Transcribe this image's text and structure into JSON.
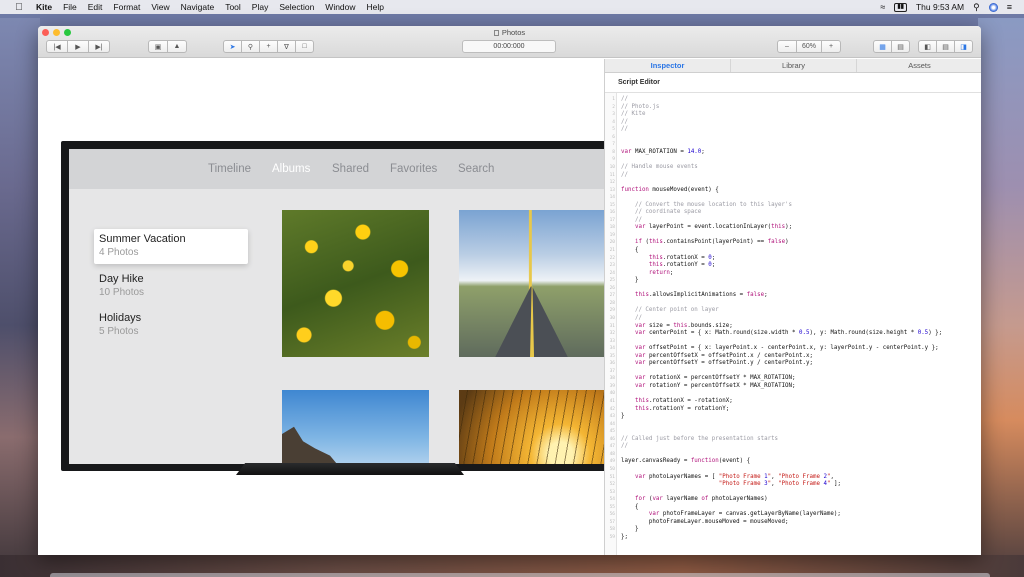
{
  "menubar": {
    "app_name": "Kite",
    "items": [
      "File",
      "Edit",
      "Format",
      "View",
      "Navigate",
      "Tool",
      "Play",
      "Selection",
      "Window",
      "Help"
    ],
    "clock": "Thu 9:53 AM"
  },
  "window": {
    "title": "Photos",
    "timecode": "00:00:000",
    "zoom": "60%"
  },
  "tv_app": {
    "nav": [
      "Timeline",
      "Albums",
      "Shared",
      "Favorites",
      "Search"
    ],
    "active_nav": "Albums",
    "albums": [
      {
        "title": "Summer Vacation",
        "count": "4 Photos"
      },
      {
        "title": "Day Hike",
        "count": "10 Photos"
      },
      {
        "title": "Holidays",
        "count": "5 Photos"
      }
    ]
  },
  "inspector": {
    "tabs": [
      "Inspector",
      "Library",
      "Assets"
    ],
    "active_tab": "Inspector",
    "section_title": "Script Editor",
    "code_lines": [
      "//",
      "// Photo.js",
      "// Kite",
      "//",
      "//",
      "",
      "",
      "var MAX_ROTATION = 14.0;",
      "",
      "// Handle mouse events",
      "//",
      "",
      "function mouseMoved(event) {",
      "",
      "    // Convert the mouse location to this layer's",
      "    // coordinate space",
      "    //",
      "    var layerPoint = event.locationInLayer(this);",
      "",
      "    if (this.containsPoint(layerPoint) == false)",
      "    {",
      "        this.rotationX = 0;",
      "        this.rotationY = 0;",
      "        return;",
      "    }",
      "",
      "    this.allowsImplicitAnimations = false;",
      "",
      "    // Center point on layer",
      "    //",
      "    var size = this.bounds.size;",
      "    var centerPoint = { x: Math.round(size.width * 0.5), y: Math.round(size.height * 0.5) };",
      "",
      "    var offsetPoint = { x: layerPoint.x - centerPoint.x, y: layerPoint.y - centerPoint.y };",
      "    var percentOffsetX = offsetPoint.x / centerPoint.x;",
      "    var percentOffsetY = offsetPoint.y / centerPoint.y;",
      "",
      "    var rotationX = percentOffsetY * MAX_ROTATION;",
      "    var rotationY = percentOffsetX * MAX_ROTATION;",
      "",
      "    this.rotationX = -rotationX;",
      "    this.rotationY = rotationY;",
      "}",
      "",
      "",
      "// Called just before the presentation starts",
      "//",
      "",
      "layer.canvasReady = function(event) {",
      "",
      "    var photoLayerNames = [ \"Photo Frame 1\", \"Photo Frame 2\",",
      "                            \"Photo Frame 3\", \"Photo Frame 4\" ];",
      "",
      "    for (var layerName of photoLayerNames)",
      "    {",
      "        var photoFrameLayer = canvas.getLayerByName(layerName);",
      "        photoFrameLayer.mouseMoved = mouseMoved;",
      "    }",
      "};"
    ]
  }
}
